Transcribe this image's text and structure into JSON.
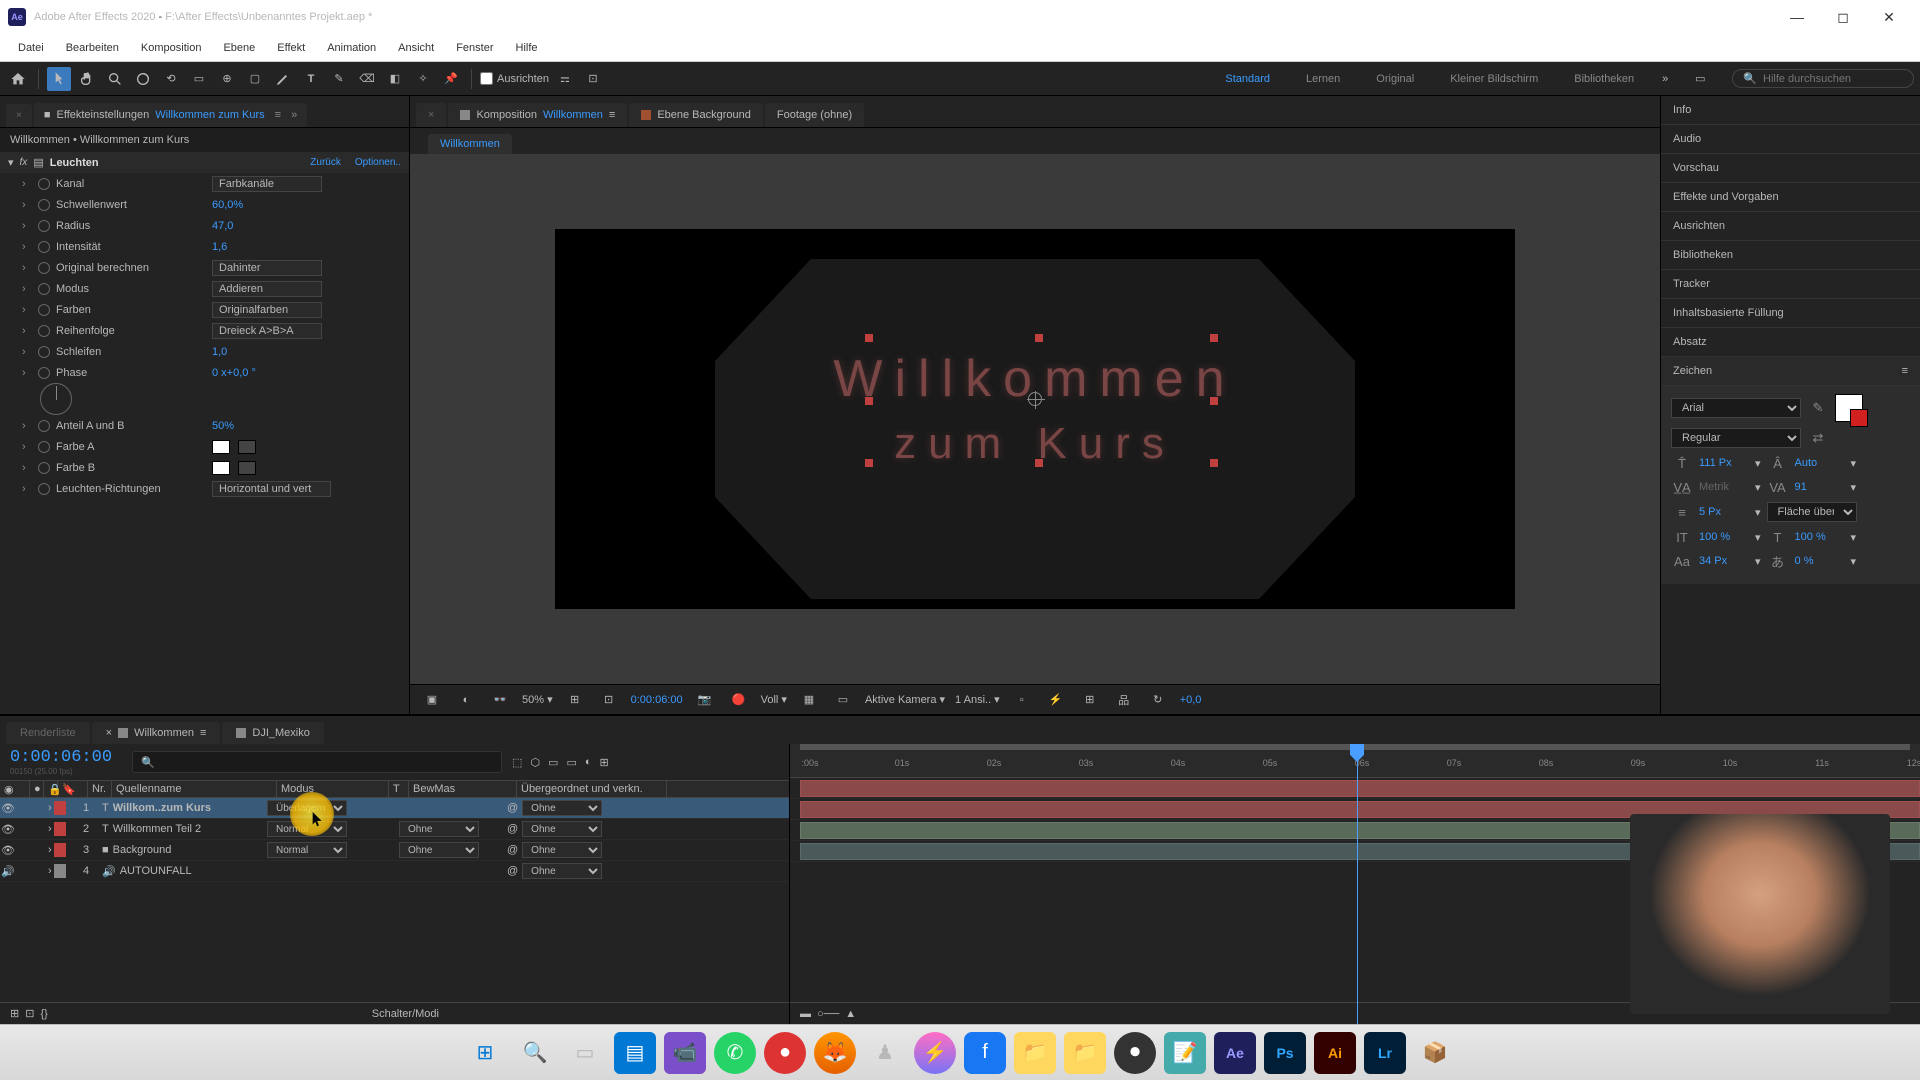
{
  "titlebar": {
    "app": "Adobe After Effects 2020",
    "path": "F:\\After Effects\\Unbenanntes Projekt.aep *"
  },
  "menubar": [
    "Datei",
    "Bearbeiten",
    "Komposition",
    "Ebene",
    "Effekt",
    "Animation",
    "Ansicht",
    "Fenster",
    "Hilfe"
  ],
  "toolbar": {
    "snap": "Ausrichten",
    "search_placeholder": "Hilfe durchsuchen"
  },
  "workspaces": [
    "Standard",
    "Lernen",
    "Original",
    "Kleiner Bildschirm",
    "Bibliotheken"
  ],
  "effects_tab": {
    "label": "Effekteinstellungen",
    "comp": "Willkommen zum Kurs"
  },
  "breadcrumb": "Willkommen • Willkommen zum Kurs",
  "fx": {
    "name": "Leuchten",
    "back": "Zurück",
    "options": "Optionen..",
    "props": [
      {
        "label": "Kanal",
        "type": "dd",
        "value": "Farbkanäle"
      },
      {
        "label": "Schwellenwert",
        "type": "val",
        "value": "60,0%"
      },
      {
        "label": "Radius",
        "type": "val",
        "value": "47,0"
      },
      {
        "label": "Intensität",
        "type": "val",
        "value": "1,6"
      },
      {
        "label": "Original berechnen",
        "type": "dd",
        "value": "Dahinter"
      },
      {
        "label": "Modus",
        "type": "dd",
        "value": "Addieren"
      },
      {
        "label": "Farben",
        "type": "dd",
        "value": "Originalfarben"
      },
      {
        "label": "Reihenfolge",
        "type": "dd",
        "value": "Dreieck A>B>A"
      },
      {
        "label": "Schleifen",
        "type": "val",
        "value": "1,0"
      },
      {
        "label": "Phase",
        "type": "phase",
        "value": "0 x+0,0 °"
      },
      {
        "label": "Anteil A und B",
        "type": "val",
        "value": "50%"
      },
      {
        "label": "Farbe A",
        "type": "color",
        "value": "#ffffff"
      },
      {
        "label": "Farbe B",
        "type": "color",
        "value": "#ffffff"
      },
      {
        "label": "Leuchten-Richtungen",
        "type": "dd",
        "value": "Horizontal und vert"
      }
    ]
  },
  "comp_tabs": [
    {
      "label": "Komposition",
      "hl": "Willkommen",
      "active": true
    },
    {
      "label": "Ebene Background"
    },
    {
      "label": "Footage (ohne)"
    }
  ],
  "flow_tab": "Willkommen",
  "canvas": {
    "line1": "Willkommen",
    "line2": "zum Kurs"
  },
  "viewerbar": {
    "zoom": "50%",
    "time": "0:00:06:00",
    "res": "Voll",
    "camera": "Aktive Kamera",
    "views": "1 Ansi..",
    "exposure": "+0,0"
  },
  "right_sections": [
    "Info",
    "Audio",
    "Vorschau",
    "Effekte und Vorgaben",
    "Ausrichten",
    "Bibliotheken",
    "Tracker",
    "Inhaltsbasierte Füllung",
    "Absatz",
    "Zeichen"
  ],
  "char": {
    "font": "Arial",
    "style": "Regular",
    "size": "111 Px",
    "leading": "Auto",
    "kerning": "Metrik",
    "tracking": "91",
    "stroke": "5 Px",
    "fill": "Fläche über Kon..",
    "hscale": "100 %",
    "vscale": "100 %",
    "baseline": "34 Px",
    "tsume": "0 %"
  },
  "timeline": {
    "tabs": [
      {
        "label": "Renderliste"
      },
      {
        "label": "Willkommen",
        "active": true
      },
      {
        "label": "DJI_Mexiko"
      }
    ],
    "timecode": "0:00:06:00",
    "sub": "00150 (25.00 fps)",
    "cols": [
      "Nr.",
      "Quellenname",
      "Modus",
      "T",
      "BewMas",
      "Übergeordnet und verkn."
    ],
    "layers": [
      {
        "n": "1",
        "name": "Willkom..zum Kurs",
        "mode": "Überlagern",
        "mask": "",
        "parent": "Ohne",
        "type": "T",
        "sel": true,
        "color": "red"
      },
      {
        "n": "2",
        "name": "Willkommen Teil 2",
        "mode": "Normal",
        "mask": "Ohne",
        "parent": "Ohne",
        "type": "T",
        "color": "red"
      },
      {
        "n": "3",
        "name": "Background",
        "mode": "Normal",
        "mask": "Ohne",
        "parent": "Ohne",
        "type": "S",
        "color": "red"
      },
      {
        "n": "4",
        "name": "AUTOUNFALL",
        "mode": "",
        "mask": "",
        "parent": "Ohne",
        "type": "A",
        "color": "grey"
      }
    ],
    "ticks": [
      ":00s",
      "01s",
      "02s",
      "03s",
      "04s",
      "05s",
      "06s",
      "07s",
      "08s",
      "09s",
      "10s",
      "11s",
      "12s"
    ],
    "footer": "Schalter/Modi"
  },
  "taskbar_icons": [
    "⊞",
    "🔍",
    "▭",
    "▤",
    "📹",
    "💬",
    "●",
    "🦊",
    "♟",
    "💬",
    "f",
    "📁",
    "📁",
    "⏺",
    "📝",
    "Ae",
    "Ps",
    "Ai",
    "Lr",
    "📦"
  ]
}
